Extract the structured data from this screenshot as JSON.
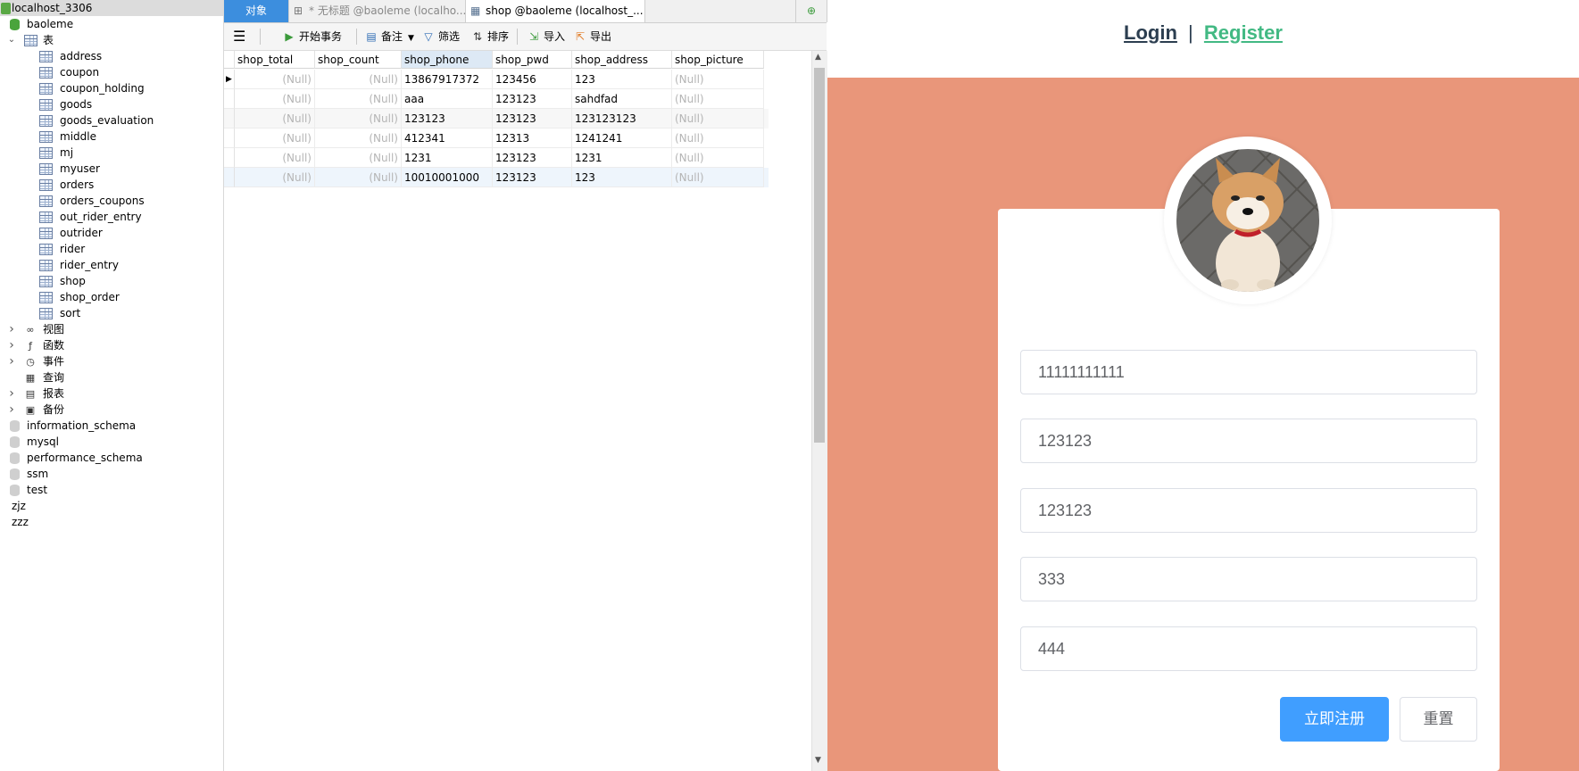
{
  "tree": {
    "connection": "localhost_3306",
    "database": "baoleme",
    "tables_group": "表",
    "tables": [
      "address",
      "coupon",
      "coupon_holding",
      "goods",
      "goods_evaluation",
      "middle",
      "mj",
      "myuser",
      "orders",
      "orders_coupons",
      "out_rider_entry",
      "outrider",
      "rider",
      "rider_entry",
      "shop",
      "shop_order",
      "sort"
    ],
    "groups": [
      "视图",
      "函数",
      "事件",
      "查询",
      "报表",
      "备份"
    ],
    "schemas": [
      "information_schema",
      "mysql",
      "performance_schema",
      "ssm",
      "test"
    ],
    "connections": [
      "zjz",
      "zzz"
    ]
  },
  "tabs": {
    "objects": "对象",
    "untitled": "* 无标题 @baoleme (localho...",
    "shop": "shop @baoleme (localhost_..."
  },
  "toolbar": {
    "begin_tx": "开始事务",
    "note": "备注",
    "filter": "筛选",
    "sort": "排序",
    "import": "导入",
    "export": "导出"
  },
  "grid": {
    "columns": [
      "shop_total",
      "shop_count",
      "shop_phone",
      "shop_pwd",
      "shop_address",
      "shop_picture"
    ],
    "rows": [
      [
        "(Null)",
        "(Null)",
        "13867917372",
        "123456",
        "123",
        "(Null)"
      ],
      [
        "(Null)",
        "(Null)",
        "aaa",
        "123123",
        "sahdfad",
        "(Null)"
      ],
      [
        "(Null)",
        "(Null)",
        "123123",
        "123123",
        "123123123",
        "(Null)"
      ],
      [
        "(Null)",
        "(Null)",
        "412341",
        "12313",
        "1241241",
        "(Null)"
      ],
      [
        "(Null)",
        "(Null)",
        "1231",
        "123123",
        "1231",
        "(Null)"
      ],
      [
        "(Null)",
        "(Null)",
        "10010001000",
        "123123",
        "123",
        "(Null)"
      ]
    ]
  },
  "web": {
    "login": "Login",
    "separator": "|",
    "register": "Register",
    "fields": [
      "11111111111",
      "123123",
      "123123",
      "333",
      "444"
    ],
    "register_button": "立即注册",
    "reset_button": "重置",
    "colors": {
      "background": "#e9967a",
      "primary": "#409eff",
      "register_link": "#42b983"
    }
  }
}
